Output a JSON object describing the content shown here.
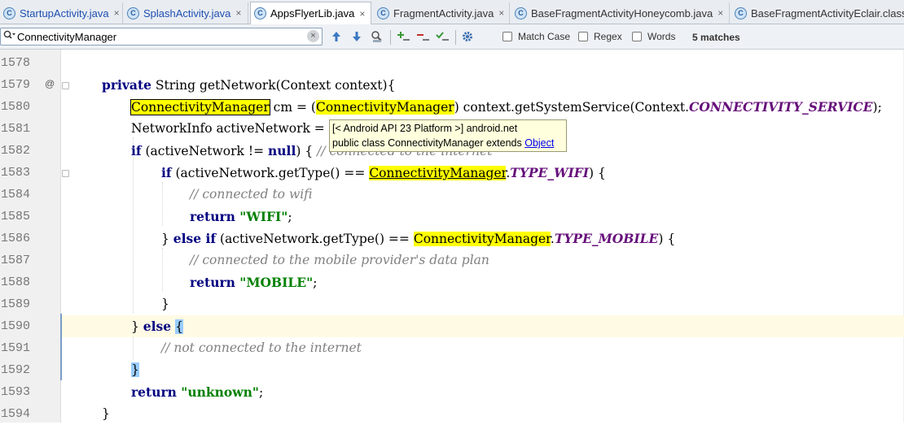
{
  "tabs": [
    {
      "label": "StartupActivity.java",
      "icon": "java-class-icon",
      "icon_letter": "C"
    },
    {
      "label": "SplashActivity.java",
      "icon": "java-class-icon",
      "icon_letter": "C"
    },
    {
      "label": "AppsFlyerLib.java",
      "icon": "java-class-icon",
      "icon_letter": "C"
    },
    {
      "label": "FragmentActivity.java",
      "icon": "java-class-icon",
      "icon_letter": "C"
    },
    {
      "label": "BaseFragmentActivityHoneycomb.java",
      "icon": "java-class-icon",
      "icon_letter": "C"
    },
    {
      "label": "BaseFragmentActivityEclair.class",
      "icon": "java-class-icon",
      "icon_letter": "C"
    }
  ],
  "close_glyph": "×",
  "search": {
    "value": "ConnectivityManager",
    "match_case": "Match Case",
    "regex": "Regex",
    "words": "Words",
    "matches": "5 matches"
  },
  "lines": [
    {
      "n": "1578"
    },
    {
      "n": "1579",
      "marker": "@"
    },
    {
      "n": "1580"
    },
    {
      "n": "1581"
    },
    {
      "n": "1582"
    },
    {
      "n": "1583"
    },
    {
      "n": "1584"
    },
    {
      "n": "1585"
    },
    {
      "n": "1586"
    },
    {
      "n": "1587"
    },
    {
      "n": "1588"
    },
    {
      "n": "1589"
    },
    {
      "n": "1590"
    },
    {
      "n": "1591"
    },
    {
      "n": "1592"
    },
    {
      "n": "1593"
    },
    {
      "n": "1594"
    }
  ],
  "code": {
    "l1579": {
      "kw": "private",
      "rest": " String getNetwork(Context context){"
    },
    "l1580": {
      "t1": "ConnectivityManager",
      "t2": " cm = (",
      "t3": "ConnectivityManager",
      "t4": ") context.getSystemService(Context.",
      "t5": "CONNECTIVITY_SERVICE",
      "t6": ");"
    },
    "l1581": {
      "t1": "NetworkInfo activeNetwork ="
    },
    "l1582": {
      "kw": "if",
      "t1": " (activeNetwork != ",
      "kw2": "null",
      "t2": ") {",
      "cmt": " // connected to the internet"
    },
    "l1583": {
      "kw": "if",
      "t1": " (activeNetwork.getType() == ",
      "t2": "ConnectivityManager",
      "t3": ".",
      "t4": "TYPE_WIFI",
      "t5": ") {"
    },
    "l1584": {
      "cmt": "// connected to wifi"
    },
    "l1585": {
      "kw": "return",
      "str": " \"WIFI\"",
      "t1": ";"
    },
    "l1586": {
      "t0": "} ",
      "kw": "else if",
      "t1": " (activeNetwork.getType() == ",
      "t2": "ConnectivityManager",
      "t3": ".",
      "t4": "TYPE_MOBILE",
      "t5": ") {"
    },
    "l1587": {
      "cmt": "// connected to the mobile provider's data plan"
    },
    "l1588": {
      "kw": "return",
      "str": " \"MOBILE\"",
      "t1": ";"
    },
    "l1589": {
      "t1": "}"
    },
    "l1590": {
      "t0": "} ",
      "kw": "else",
      "t1": " ",
      "t2": "{"
    },
    "l1591": {
      "cmt": "// not connected to the internet"
    },
    "l1592": {
      "t1": "}"
    },
    "l1593": {
      "kw": "return",
      "str": " \"unknown\"",
      "t1": ";"
    },
    "l1594": {
      "t1": "}"
    }
  },
  "tooltip": {
    "line1": "[< Android API 23 Platform >] android.net",
    "line2": "public class ConnectivityManager extends ",
    "link": "Object"
  }
}
